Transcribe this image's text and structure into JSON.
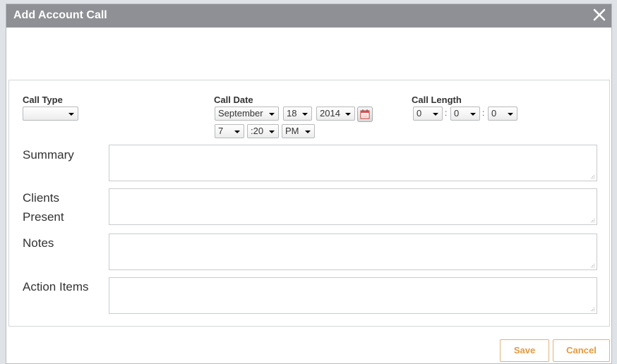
{
  "dialog": {
    "title": "Add Account Call",
    "close_icon": "close-icon"
  },
  "call_type": {
    "label": "Call Type",
    "value": ""
  },
  "call_date": {
    "label": "Call Date",
    "month": "September",
    "day": "18",
    "year": "2014",
    "hour": "7",
    "minute": ":20",
    "ampm": "PM",
    "calendar_icon": "calendar-icon"
  },
  "call_length": {
    "label": "Call Length",
    "hours": "0",
    "minutes": "0",
    "seconds": "0",
    "separator": ":"
  },
  "fields": {
    "summary": {
      "label": "Summary",
      "value": ""
    },
    "clients_present": {
      "label_line1": "Clients",
      "label_line2": "Present",
      "value": ""
    },
    "notes": {
      "label": "Notes",
      "value": ""
    },
    "action_items": {
      "label": "Action Items",
      "value": ""
    }
  },
  "footer": {
    "save_label": "Save",
    "cancel_label": "Cancel"
  },
  "colors": {
    "titlebar": "#8e9095",
    "button_accent": "#e39a40",
    "calendar_accent": "#d9534f"
  }
}
